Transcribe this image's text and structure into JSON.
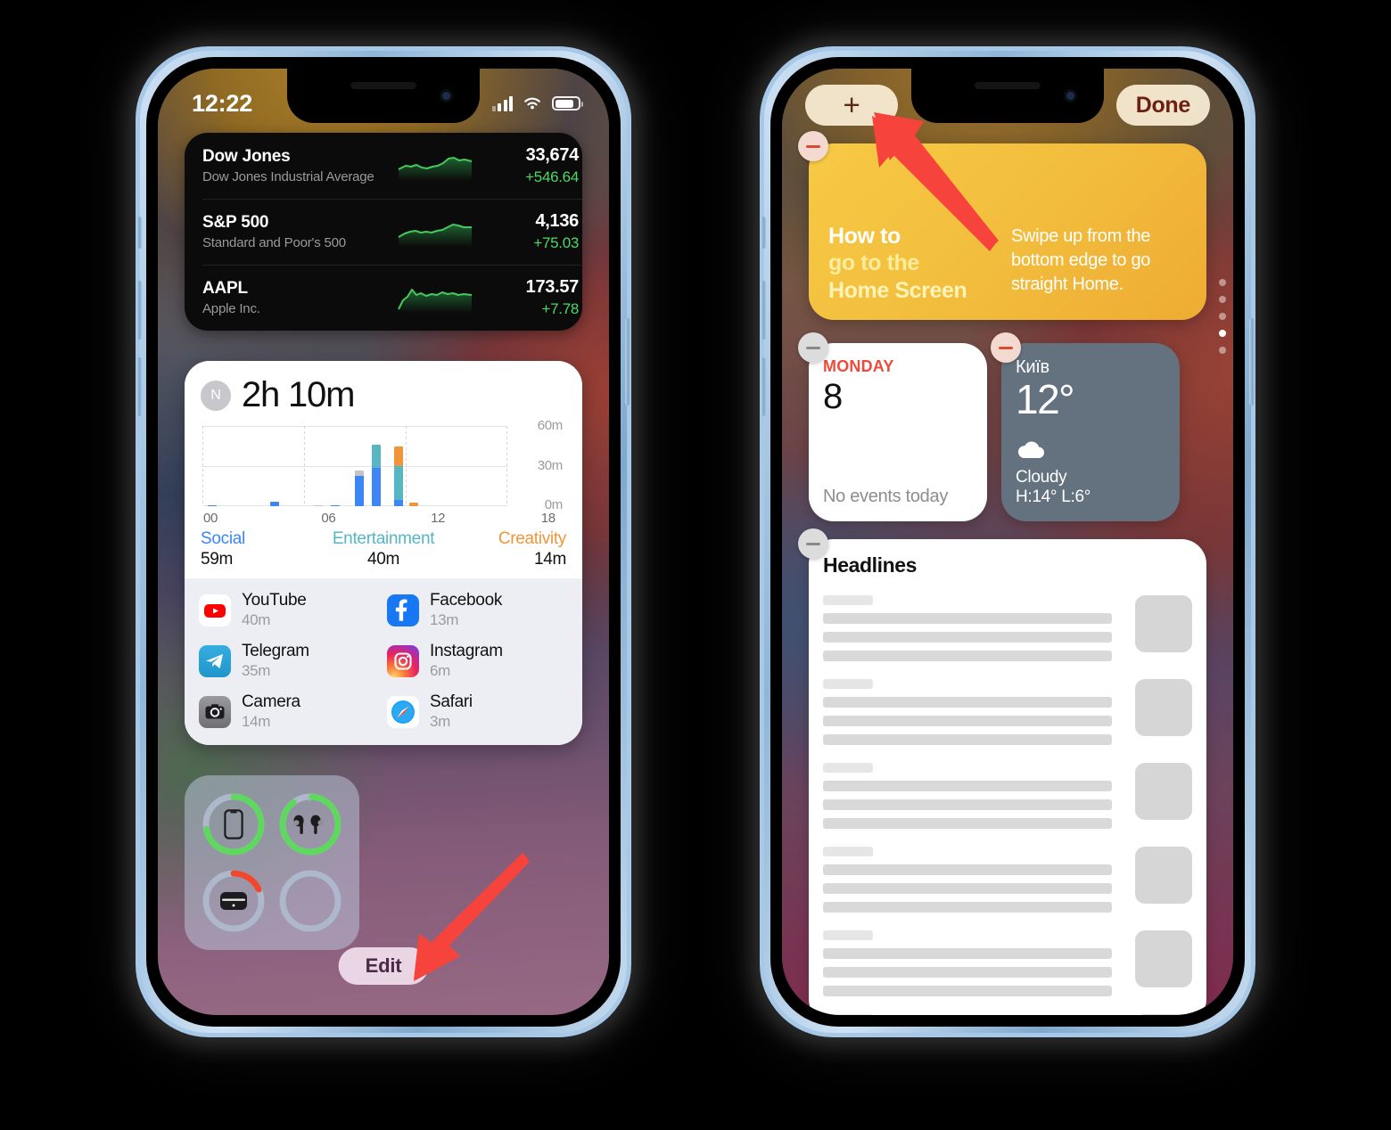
{
  "left_phone": {
    "status_bar": {
      "time": "12:22",
      "signal_icon": "cellular-signal-icon",
      "wifi_icon": "wifi-icon",
      "battery_icon": "battery-icon"
    },
    "stocks_widget": {
      "rows": [
        {
          "symbol": "Dow Jones",
          "name": "Dow Jones Industrial Average",
          "price": "33,674",
          "change": "+546.64"
        },
        {
          "symbol": "S&P 500",
          "name": "Standard and Poor's 500",
          "price": "4,136",
          "change": "+75.03"
        },
        {
          "symbol": "AAPL",
          "name": "Apple Inc.",
          "price": "173.57",
          "change": "+7.78"
        }
      ],
      "positive_color": "#4cd964"
    },
    "screen_time_widget": {
      "avatar_initial": "N",
      "total": "2h 10m",
      "categories": [
        {
          "name": "Social",
          "value": "59m",
          "color": "#3d86f5"
        },
        {
          "name": "Entertainment",
          "value": "40m",
          "color": "#56b6c2"
        },
        {
          "name": "Creativity",
          "value": "14m",
          "color": "#f0953a"
        }
      ],
      "apps": [
        {
          "name": "YouTube",
          "time": "40m",
          "icon": "youtube-icon"
        },
        {
          "name": "Facebook",
          "time": "13m",
          "icon": "facebook-icon"
        },
        {
          "name": "Telegram",
          "time": "35m",
          "icon": "telegram-icon"
        },
        {
          "name": "Instagram",
          "time": "6m",
          "icon": "instagram-icon"
        },
        {
          "name": "Camera",
          "time": "14m",
          "icon": "camera-icon"
        },
        {
          "name": "Safari",
          "time": "3m",
          "icon": "safari-icon"
        }
      ]
    },
    "batteries_widget": {
      "items": [
        {
          "device": "iphone",
          "percent": 72,
          "color": "#5fd860",
          "charging": false
        },
        {
          "device": "airpods",
          "percent": 88,
          "color": "#5fd860",
          "charging": true
        },
        {
          "device": "airpods-case",
          "percent": 18,
          "color": "#f0482f",
          "charging": false
        },
        {
          "device": "empty",
          "percent": 0,
          "color": "#b9c2d4",
          "charging": false
        }
      ]
    },
    "edit_button_label": "Edit",
    "callout_arrow": "red-arrow-pointing-to-edit-button"
  },
  "right_phone": {
    "add_widget_button": "+",
    "done_button": "Done",
    "callout_arrow": "red-arrow-pointing-to-add-button",
    "page_dots": {
      "count": 5,
      "active_index": 3
    },
    "tip_widget": {
      "line1": "How to",
      "line2": "go to the",
      "line3": "Home Screen",
      "body": "Swipe up from the bottom edge to go straight Home."
    },
    "calendar_widget": {
      "weekday": "MONDAY",
      "day": "8",
      "events": "No events today"
    },
    "weather_widget": {
      "city": "Київ",
      "temperature": "12°",
      "condition": "Cloudy",
      "high_low": "H:14° L:6°",
      "icon": "cloud-icon"
    },
    "news_widget": {
      "title": "Headlines",
      "placeholder_items": 6
    },
    "remove_buttons_label": "−"
  },
  "chart_data": {
    "type": "bar",
    "title": "2h 10m",
    "xlabel": "",
    "ylabel": "",
    "ylim": [
      0,
      60
    ],
    "yticks": [
      "0m",
      "30m",
      "60m"
    ],
    "xticks": [
      "00",
      "06",
      "12",
      "18"
    ],
    "grid": true,
    "legend": [
      "Social",
      "Entertainment",
      "Creativity"
    ],
    "series": [
      {
        "name": "Social",
        "color": "#3d86f5",
        "total": "59m"
      },
      {
        "name": "Entertainment",
        "color": "#56b6c2",
        "total": "40m"
      },
      {
        "name": "Creativity",
        "color": "#f0953a",
        "total": "14m"
      },
      {
        "name": "Other",
        "color": "#c4c4c8",
        "total": ""
      }
    ],
    "x": [
      0.3,
      4.0,
      6.6,
      7.6,
      9.0,
      10.0,
      11.3,
      12.2
    ],
    "stacks": [
      {
        "hour": 0.3,
        "Social": 0.8,
        "Entertainment": 0,
        "Creativity": 0,
        "Other": 0
      },
      {
        "hour": 4.0,
        "Social": 3.5,
        "Entertainment": 0,
        "Creativity": 0,
        "Other": 0
      },
      {
        "hour": 6.6,
        "Social": 0,
        "Entertainment": 0,
        "Creativity": 0,
        "Other": 0.8
      },
      {
        "hour": 7.6,
        "Social": 0.9,
        "Entertainment": 0,
        "Creativity": 0,
        "Other": 0
      },
      {
        "hour": 9.0,
        "Social": 23,
        "Entertainment": 0,
        "Creativity": 0,
        "Other": 4
      },
      {
        "hour": 10.0,
        "Social": 29,
        "Entertainment": 17,
        "Creativity": 0,
        "Other": 0
      },
      {
        "hour": 11.3,
        "Social": 5,
        "Entertainment": 25,
        "Creativity": 15,
        "Other": 0
      },
      {
        "hour": 12.2,
        "Social": 0,
        "Entertainment": 0,
        "Creativity": 3,
        "Other": 0
      }
    ]
  }
}
